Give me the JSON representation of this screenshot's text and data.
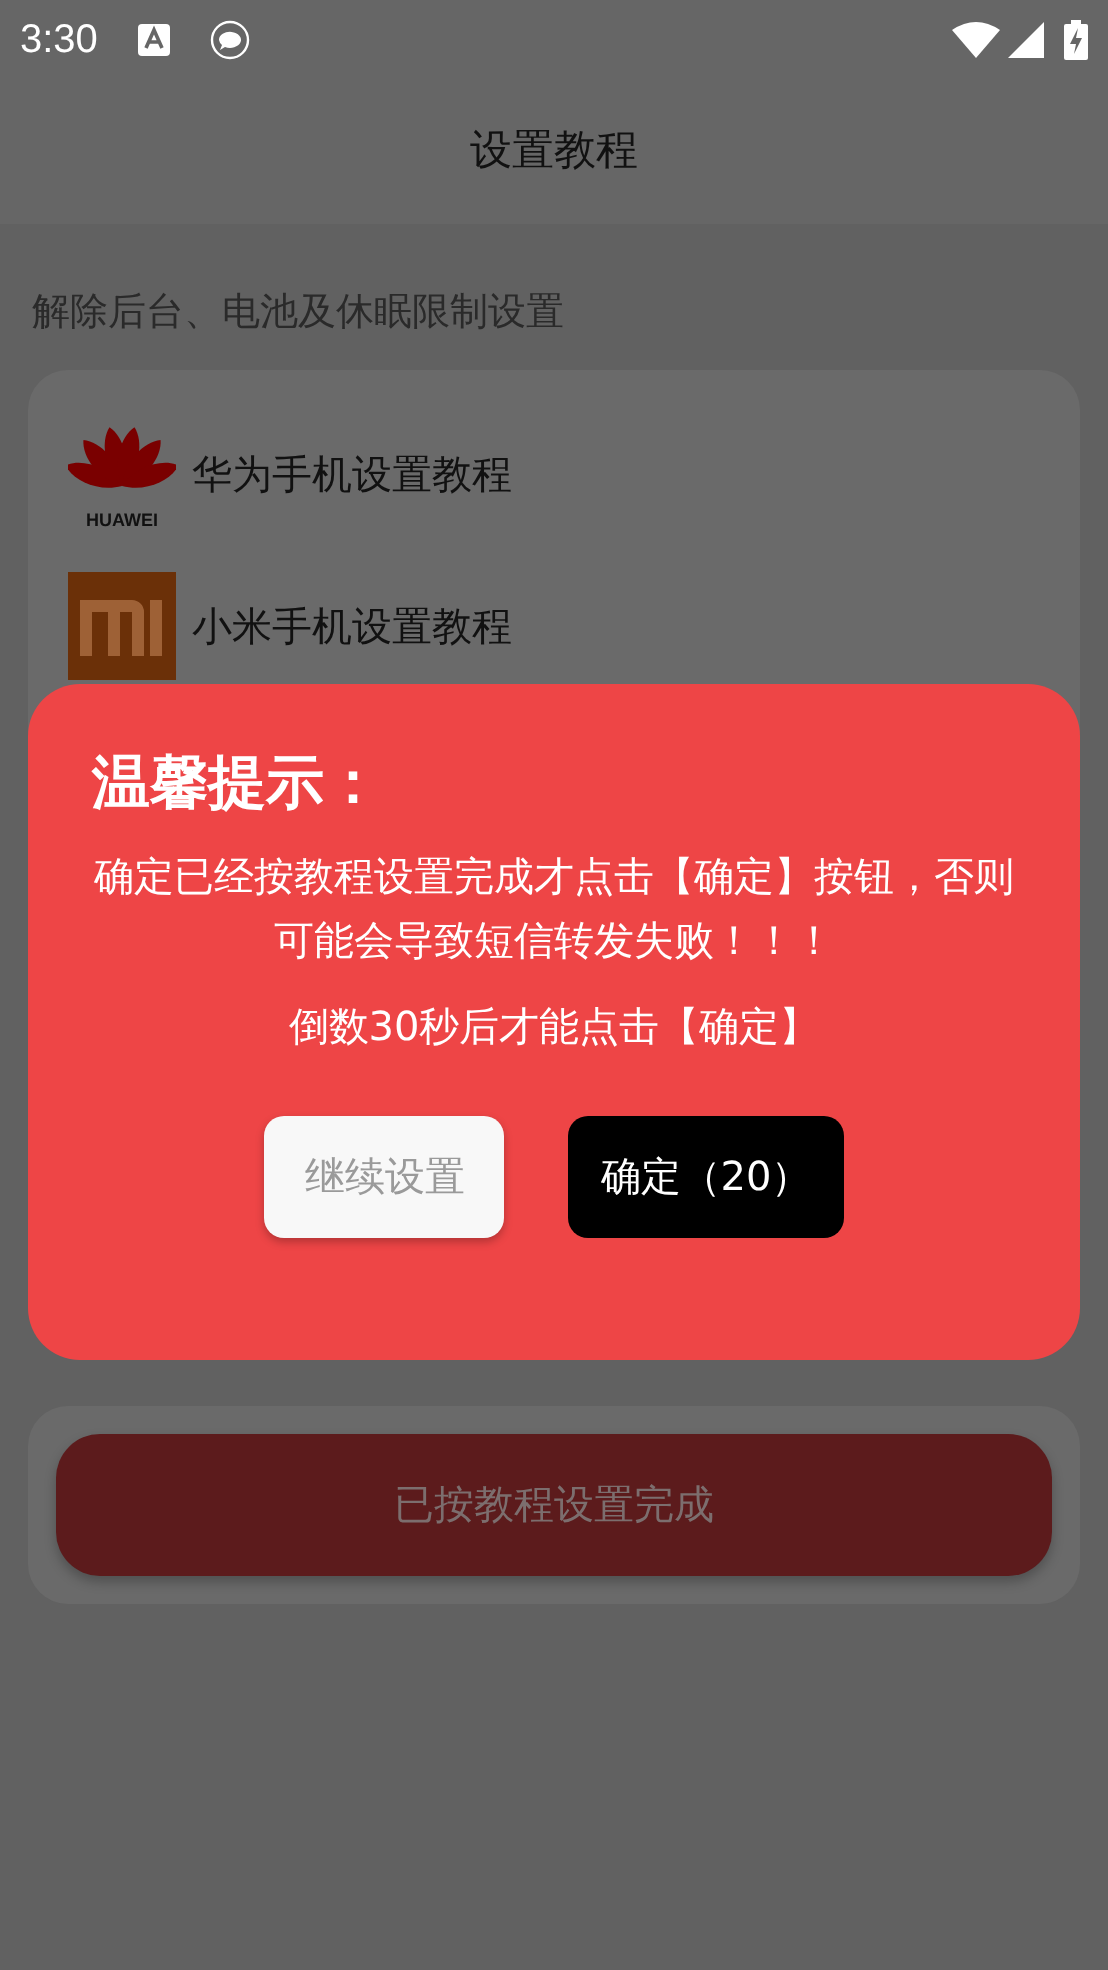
{
  "status_bar": {
    "time": "3:30"
  },
  "app_bar": {
    "title": "设置教程"
  },
  "section_label": "解除后台、电池及休眠限制设置",
  "tutorials": [
    {
      "kind": "huawei",
      "logo_text": "HUAWEI",
      "label": "华为手机设置教程"
    },
    {
      "kind": "xiaomi",
      "label": "小米手机设置教程"
    }
  ],
  "done_button": {
    "label": "已按教程设置完成"
  },
  "dialog": {
    "title": "温馨提示：",
    "message": "确定已经按教程设置完成才点击【确定】按钮，否则可能会导致短信转发失败！！！",
    "countdown": "倒数30秒后才能点击【确定】",
    "buttons": [
      {
        "kind": "secondary",
        "label": "继续设置"
      },
      {
        "kind": "primary",
        "label": "确定（20）"
      }
    ]
  }
}
